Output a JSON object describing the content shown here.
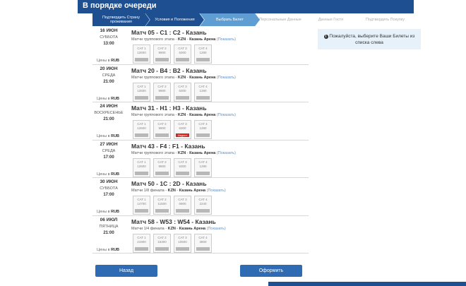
{
  "header": {
    "title": "В порядке очереди"
  },
  "steps": [
    "Подтвердить Страну проживания",
    "Условия и Положения",
    "Выбрать Билет",
    "Персональные Данные",
    "Данные Гостя",
    "Подтвердить Покупку"
  ],
  "prices_label": "Цены в",
  "currency": "RUB",
  "show_link": "(Показать)",
  "sold_out_label": "Недост",
  "matches": [
    {
      "date": "16 ИЮН",
      "dow": "СУББОТА",
      "time": "13:00",
      "title": "Матч 05 - C1 : C2 - Казань",
      "stage": "Матчи группового этапа",
      "city_code": "KZN",
      "venue": "Казань Арена",
      "cats": [
        {
          "label": "CAT 1",
          "price": "12600"
        },
        {
          "label": "CAT 2",
          "price": "9900"
        },
        {
          "label": "CAT 3",
          "price": "6300"
        },
        {
          "label": "CAT 4",
          "price": "1280"
        }
      ]
    },
    {
      "date": "20 ИЮН",
      "dow": "СРЕДА",
      "time": "21:00",
      "title": "Матч 20 - B4 : B2 - Казань",
      "stage": "Матчи группового этапа",
      "city_code": "KZN",
      "venue": "Казань Арена",
      "cats": [
        {
          "label": "CAT 1",
          "price": "12600"
        },
        {
          "label": "CAT 2",
          "price": "9900"
        },
        {
          "label": "CAT 3",
          "price": "6300"
        },
        {
          "label": "CAT 4",
          "price": "1280"
        }
      ]
    },
    {
      "date": "24 ИЮН",
      "dow": "ВОСКРЕСЕНЬЕ",
      "time": "21:00",
      "title": "Матч 31 - H1 : H3 - Казань",
      "stage": "Матчи группового этапа",
      "city_code": "KZN",
      "venue": "Казань Арена",
      "cats": [
        {
          "label": "CAT 1",
          "price": "12600"
        },
        {
          "label": "CAT 2",
          "price": "9900"
        },
        {
          "label": "CAT 3",
          "price": "6300",
          "sold_out": true
        },
        {
          "label": "CAT 4",
          "price": "1280"
        }
      ]
    },
    {
      "date": "27 ИЮН",
      "dow": "СРЕДА",
      "time": "17:00",
      "title": "Матч 43 - F4 : F1 - Казань",
      "stage": "Матчи группового этапа",
      "city_code": "KZN",
      "venue": "Казань Арена",
      "cats": [
        {
          "label": "CAT 1",
          "price": "12600"
        },
        {
          "label": "CAT 2",
          "price": "9900"
        },
        {
          "label": "CAT 3",
          "price": "6300"
        },
        {
          "label": "CAT 4",
          "price": "1280"
        }
      ]
    },
    {
      "date": "30 ИЮН",
      "dow": "СУББОТА",
      "time": "17:00",
      "title": "Матч 50 - 1C : 2D - Казань",
      "stage": "Матчи 1/8 финала",
      "city_code": "KZN",
      "venue": "Казань Арена",
      "cats": [
        {
          "label": "CAT 1",
          "price": "14700"
        },
        {
          "label": "CAT 2",
          "price": "11500"
        },
        {
          "label": "CAT 3",
          "price": "6900"
        },
        {
          "label": "CAT 4",
          "price": "2240"
        }
      ]
    },
    {
      "date": "06 ИЮЛ",
      "dow": "ПЯТНИЦА",
      "time": "21:00",
      "title": "Матч 58 - W53 : W54 - Казань",
      "stage": "Матчи 1/4 финала",
      "city_code": "KZN",
      "venue": "Казань Арена",
      "cats": [
        {
          "label": "CAT 1",
          "price": "21900"
        },
        {
          "label": "CAT 2",
          "price": "15300"
        },
        {
          "label": "CAT 3",
          "price": "10500"
        },
        {
          "label": "CAT 4",
          "price": "3800"
        }
      ]
    }
  ],
  "info": {
    "icon": "info-icon",
    "text": "Пожалуйста, выберите Ваши Билеты из списка слева"
  },
  "buttons": {
    "back": "Назад",
    "order": "Оформить"
  },
  "colors": {
    "brand": "#1d4f91",
    "step_active": "#5f9ed3",
    "button": "#2f6bb3",
    "sold_out": "#d9261c",
    "info_bg": "#e6f1fa"
  }
}
